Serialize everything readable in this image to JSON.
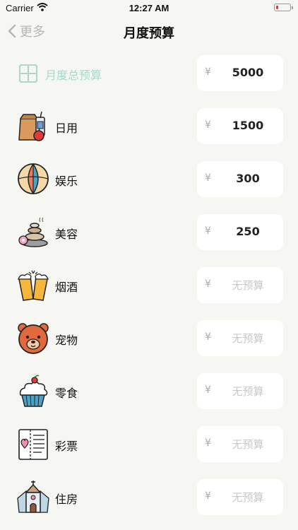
{
  "status": {
    "carrier": "Carrier",
    "time": "12:27 AM"
  },
  "nav": {
    "back_label": "更多",
    "title": "月度预算"
  },
  "currency_symbol": "¥",
  "total": {
    "label": "月度总预算",
    "amount": "5000"
  },
  "categories": [
    {
      "label": "日用",
      "amount": "1500",
      "icon": "shopping-bag-icon"
    },
    {
      "label": "娱乐",
      "amount": "300",
      "icon": "beach-ball-icon"
    },
    {
      "label": "美容",
      "amount": "250",
      "icon": "spa-stones-icon"
    },
    {
      "label": "烟酒",
      "amount": "无预算",
      "icon": "beer-cheers-icon"
    },
    {
      "label": "宠物",
      "amount": "无预算",
      "icon": "bear-icon"
    },
    {
      "label": "零食",
      "amount": "无预算",
      "icon": "cupcake-icon"
    },
    {
      "label": "彩票",
      "amount": "无预算",
      "icon": "lottery-ticket-icon"
    },
    {
      "label": "住房",
      "amount": "无预算",
      "icon": "house-icon"
    }
  ]
}
